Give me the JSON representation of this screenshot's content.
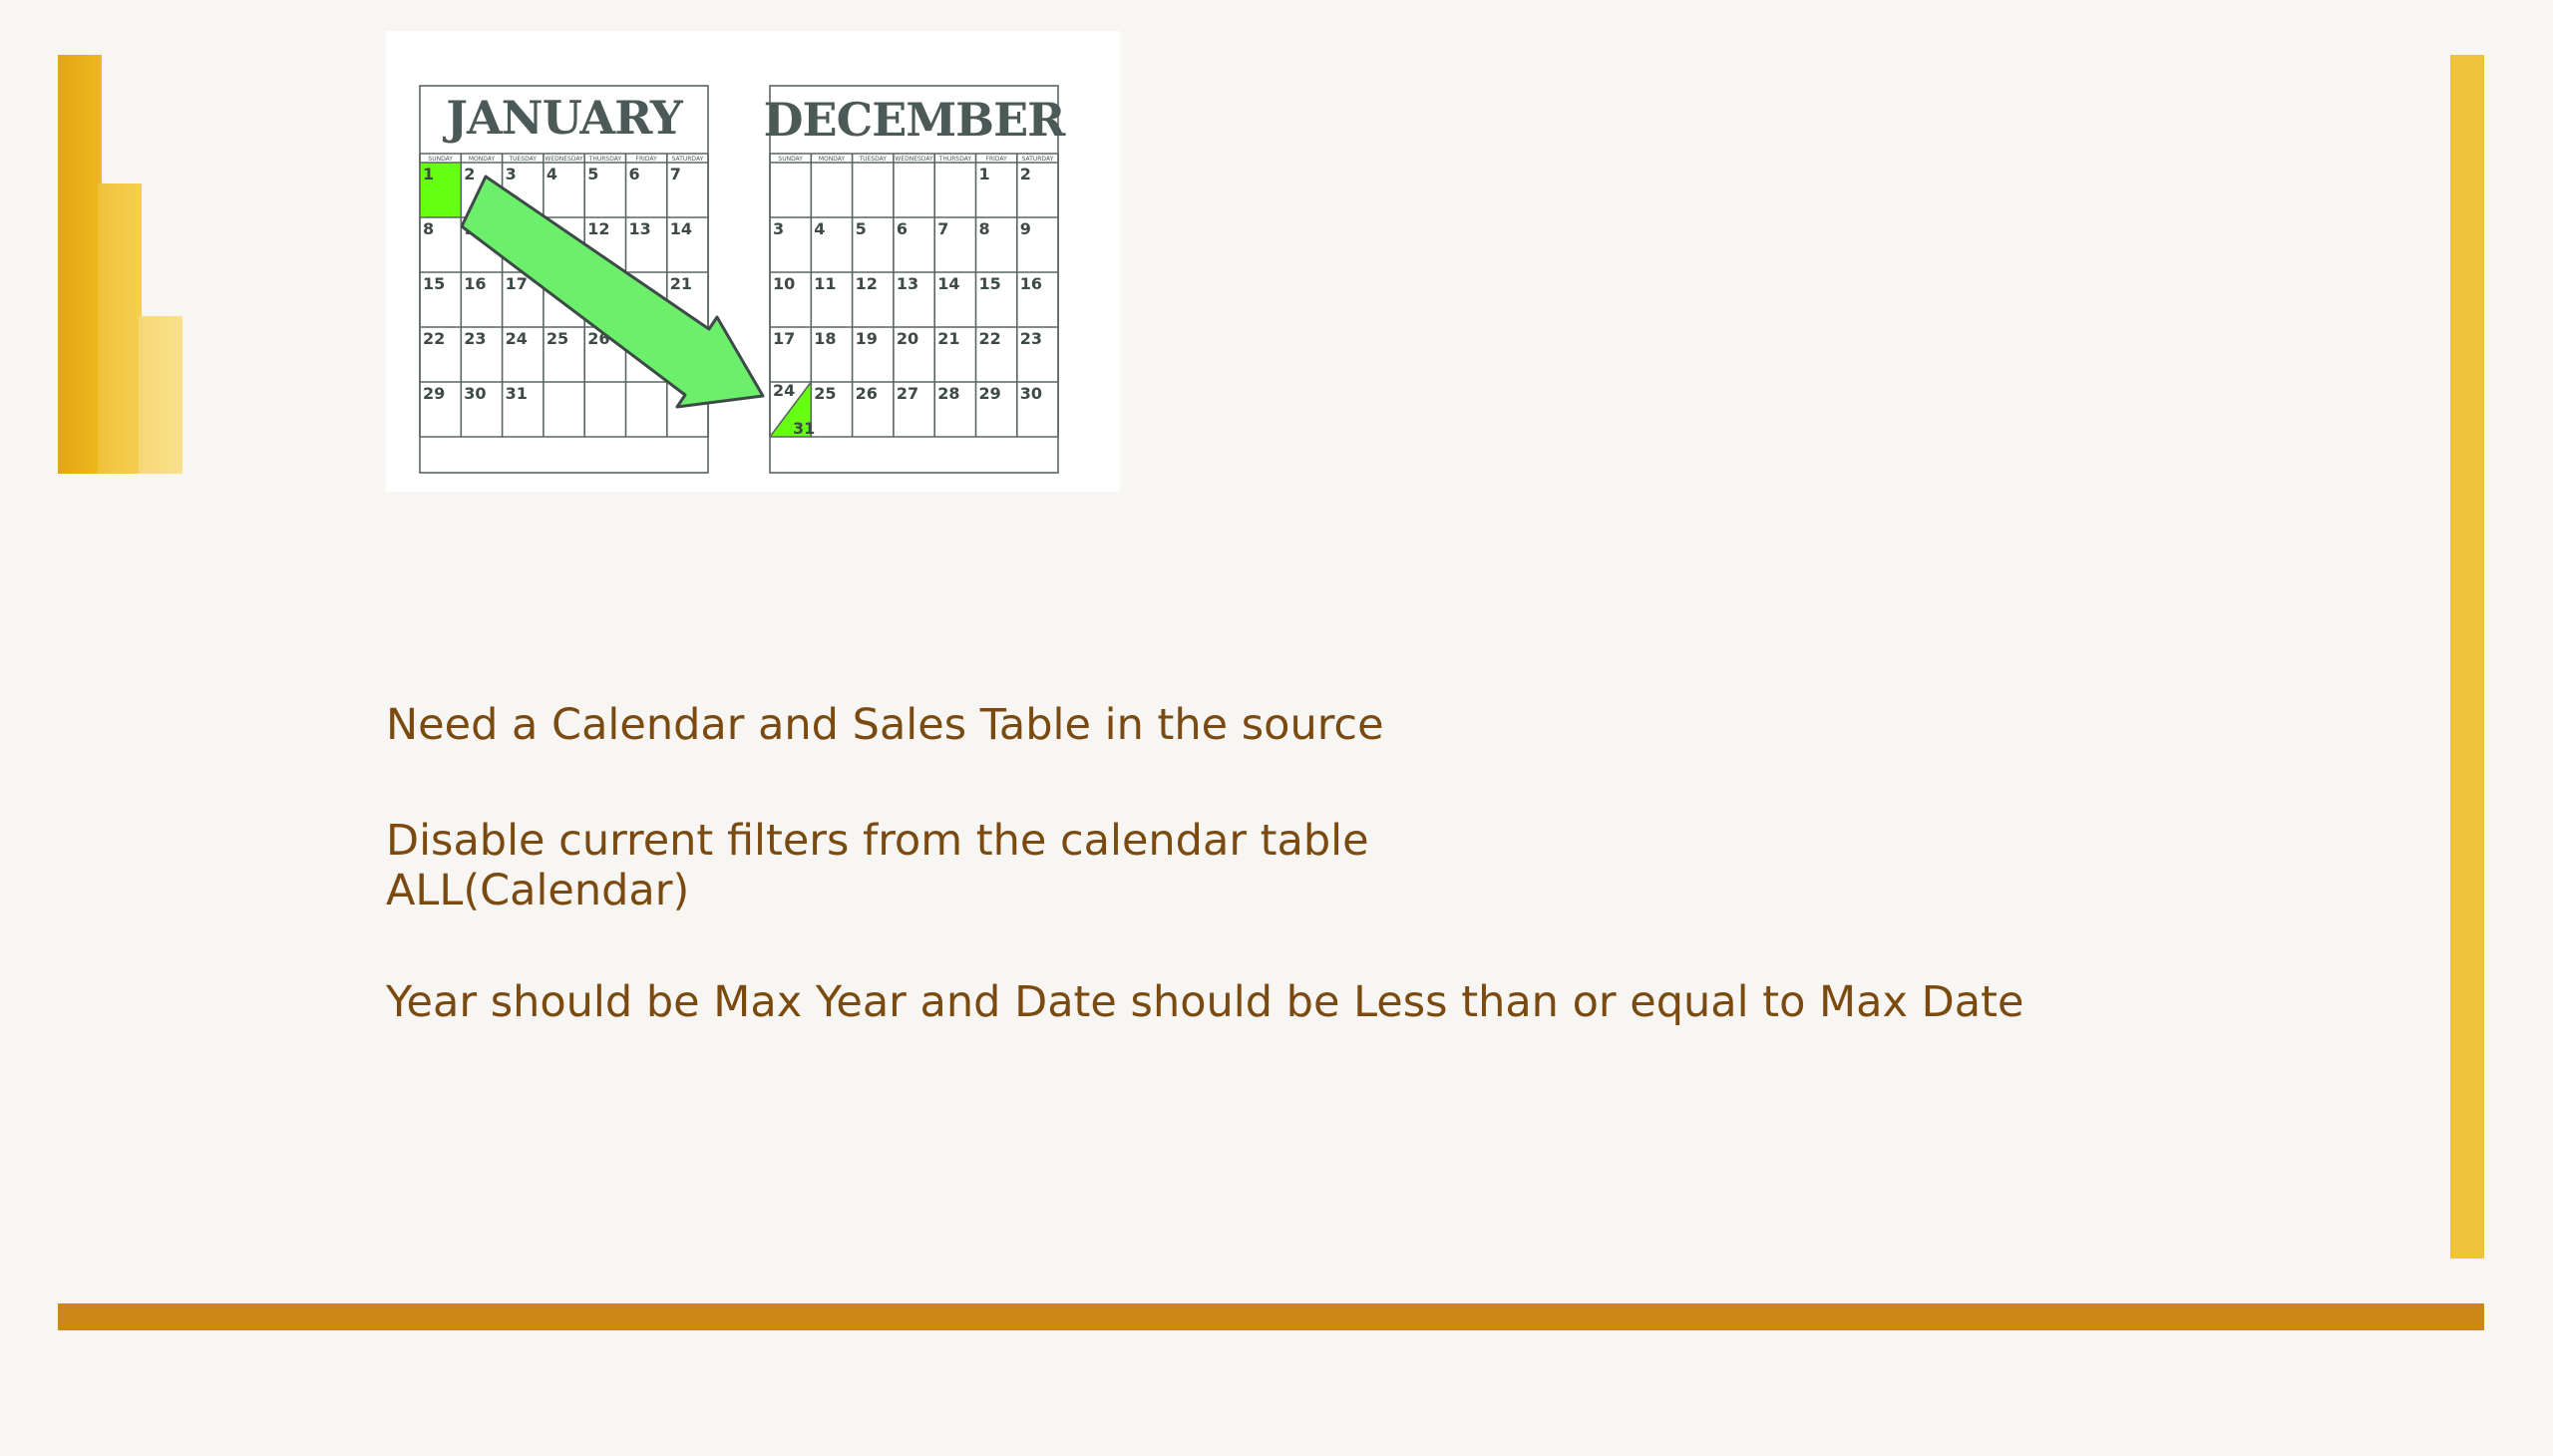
{
  "slide": {
    "bullets": {
      "line1": "Need a Calendar and Sales Table in the source",
      "line2": "Disable current filters from the calendar table",
      "line3": "ALL(Calendar)",
      "line4": "Year should be Max Year and Date should be Less than or equal to Max Date"
    }
  },
  "image": {
    "january": {
      "title": "JANUARY",
      "day_headers": [
        "SUNDAY",
        "MONDAY",
        "TUESDAY",
        "WEDNESDAY",
        "THURSDAY",
        "FRIDAY",
        "SATURDAY"
      ],
      "weeks": [
        [
          "1",
          "2",
          "3",
          "4",
          "5",
          "6",
          "7"
        ],
        [
          "8",
          "9",
          "",
          "",
          "12",
          "13",
          "14"
        ],
        [
          "15",
          "16",
          "17",
          "18",
          "",
          "",
          "21"
        ],
        [
          "22",
          "23",
          "24",
          "25",
          "26",
          "27",
          ""
        ],
        [
          "29",
          "30",
          "31",
          "",
          "",
          "",
          ""
        ]
      ],
      "highlighted_day": "1"
    },
    "december": {
      "title": "DECEMBER",
      "day_headers": [
        "SUNDAY",
        "MONDAY",
        "TUESDAY",
        "WEDNESDAY",
        "THURSDAY",
        "FRIDAY",
        "SATURDAY"
      ],
      "weeks": [
        [
          "",
          "",
          "",
          "",
          "",
          "1",
          "2"
        ],
        [
          "3",
          "4",
          "5",
          "6",
          "7",
          "8",
          "9"
        ],
        [
          "10",
          "11",
          "12",
          "13",
          "14",
          "15",
          "16"
        ],
        [
          "17",
          "18",
          "19",
          "20",
          "21",
          "22",
          "23"
        ],
        [
          "24",
          "25",
          "26",
          "27",
          "28",
          "29",
          "30"
        ]
      ],
      "split_cell_bottom": "31",
      "highlighted_day": "31"
    },
    "colors": {
      "highlight": "#66ff11",
      "arrow_fill": "#6cf06c",
      "arrow_stroke": "#3e4a48"
    }
  },
  "theme": {
    "logo_colors": [
      "#e2a514",
      "#f0c23a",
      "#f6d876"
    ],
    "accent_bar": "#efc33a",
    "bottom_bar": "#cd8714",
    "text_color": "#7a4a10",
    "background": "#f8f6f2"
  }
}
